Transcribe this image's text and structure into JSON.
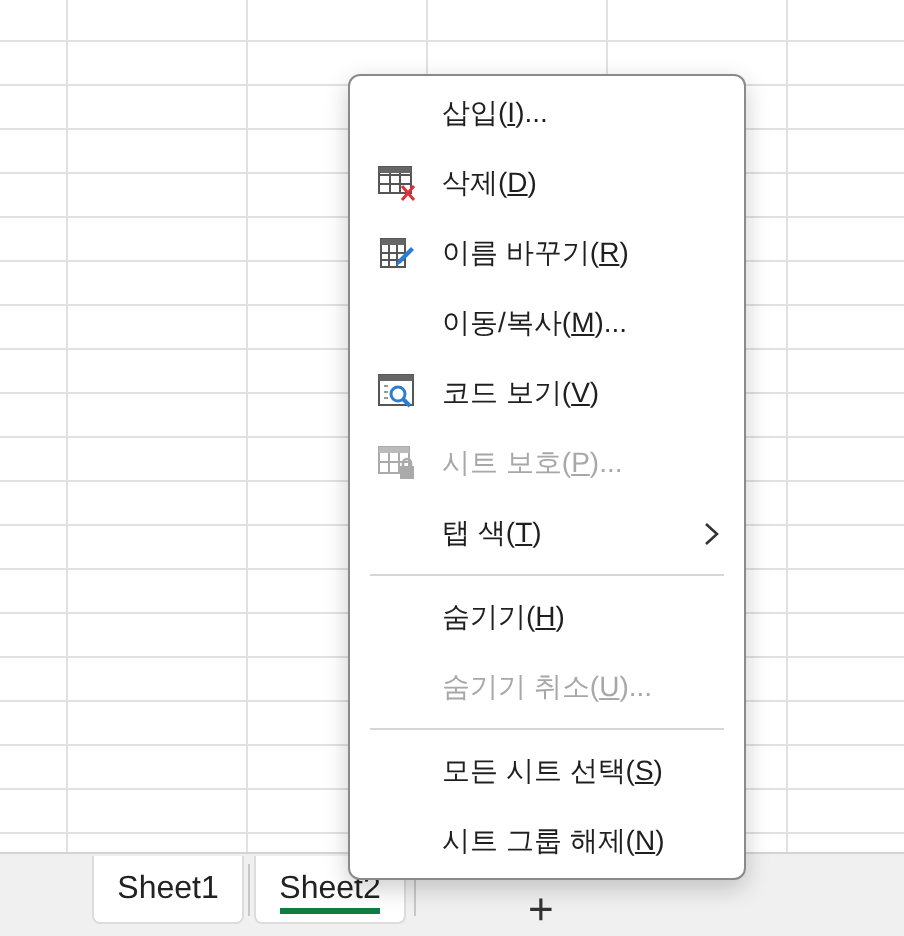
{
  "sheet_tabs": [
    {
      "label": "Sheet1",
      "selected": false
    },
    {
      "label": "Sheet2",
      "selected": true
    }
  ],
  "add_sheet": "+",
  "context_menu": [
    {
      "kind": "item",
      "label": "삽입(",
      "key": "I",
      "after": ")...",
      "disabled": false
    },
    {
      "kind": "item",
      "label": "삭제(",
      "key": "D",
      "after": ")",
      "disabled": false
    },
    {
      "kind": "item",
      "label": "이름 바꾸기(",
      "key": "R",
      "after": ")",
      "disabled": false
    },
    {
      "kind": "item",
      "label": "이동/복사(",
      "key": "M",
      "after": ")...",
      "disabled": false
    },
    {
      "kind": "item",
      "label": "코드 보기(",
      "key": "V",
      "after": ")",
      "disabled": false
    },
    {
      "kind": "item",
      "label": "시트 보호(",
      "key": "P",
      "after": ")...",
      "disabled": true
    },
    {
      "kind": "item",
      "label": "탭 색(",
      "key": "T",
      "after": ")",
      "disabled": false,
      "submenu": true
    },
    {
      "kind": "separator"
    },
    {
      "kind": "item",
      "label": "숨기기(",
      "key": "H",
      "after": ")",
      "disabled": false
    },
    {
      "kind": "item",
      "label": "숨기기 취소(",
      "key": "U",
      "after": ")...",
      "disabled": true
    },
    {
      "kind": "separator"
    },
    {
      "kind": "item",
      "label": "모든 시트 선택(",
      "key": "S",
      "after": ")",
      "disabled": false
    },
    {
      "kind": "item",
      "label": "시트 그룹 해제(",
      "key": "N",
      "after": ")",
      "disabled": false
    }
  ]
}
